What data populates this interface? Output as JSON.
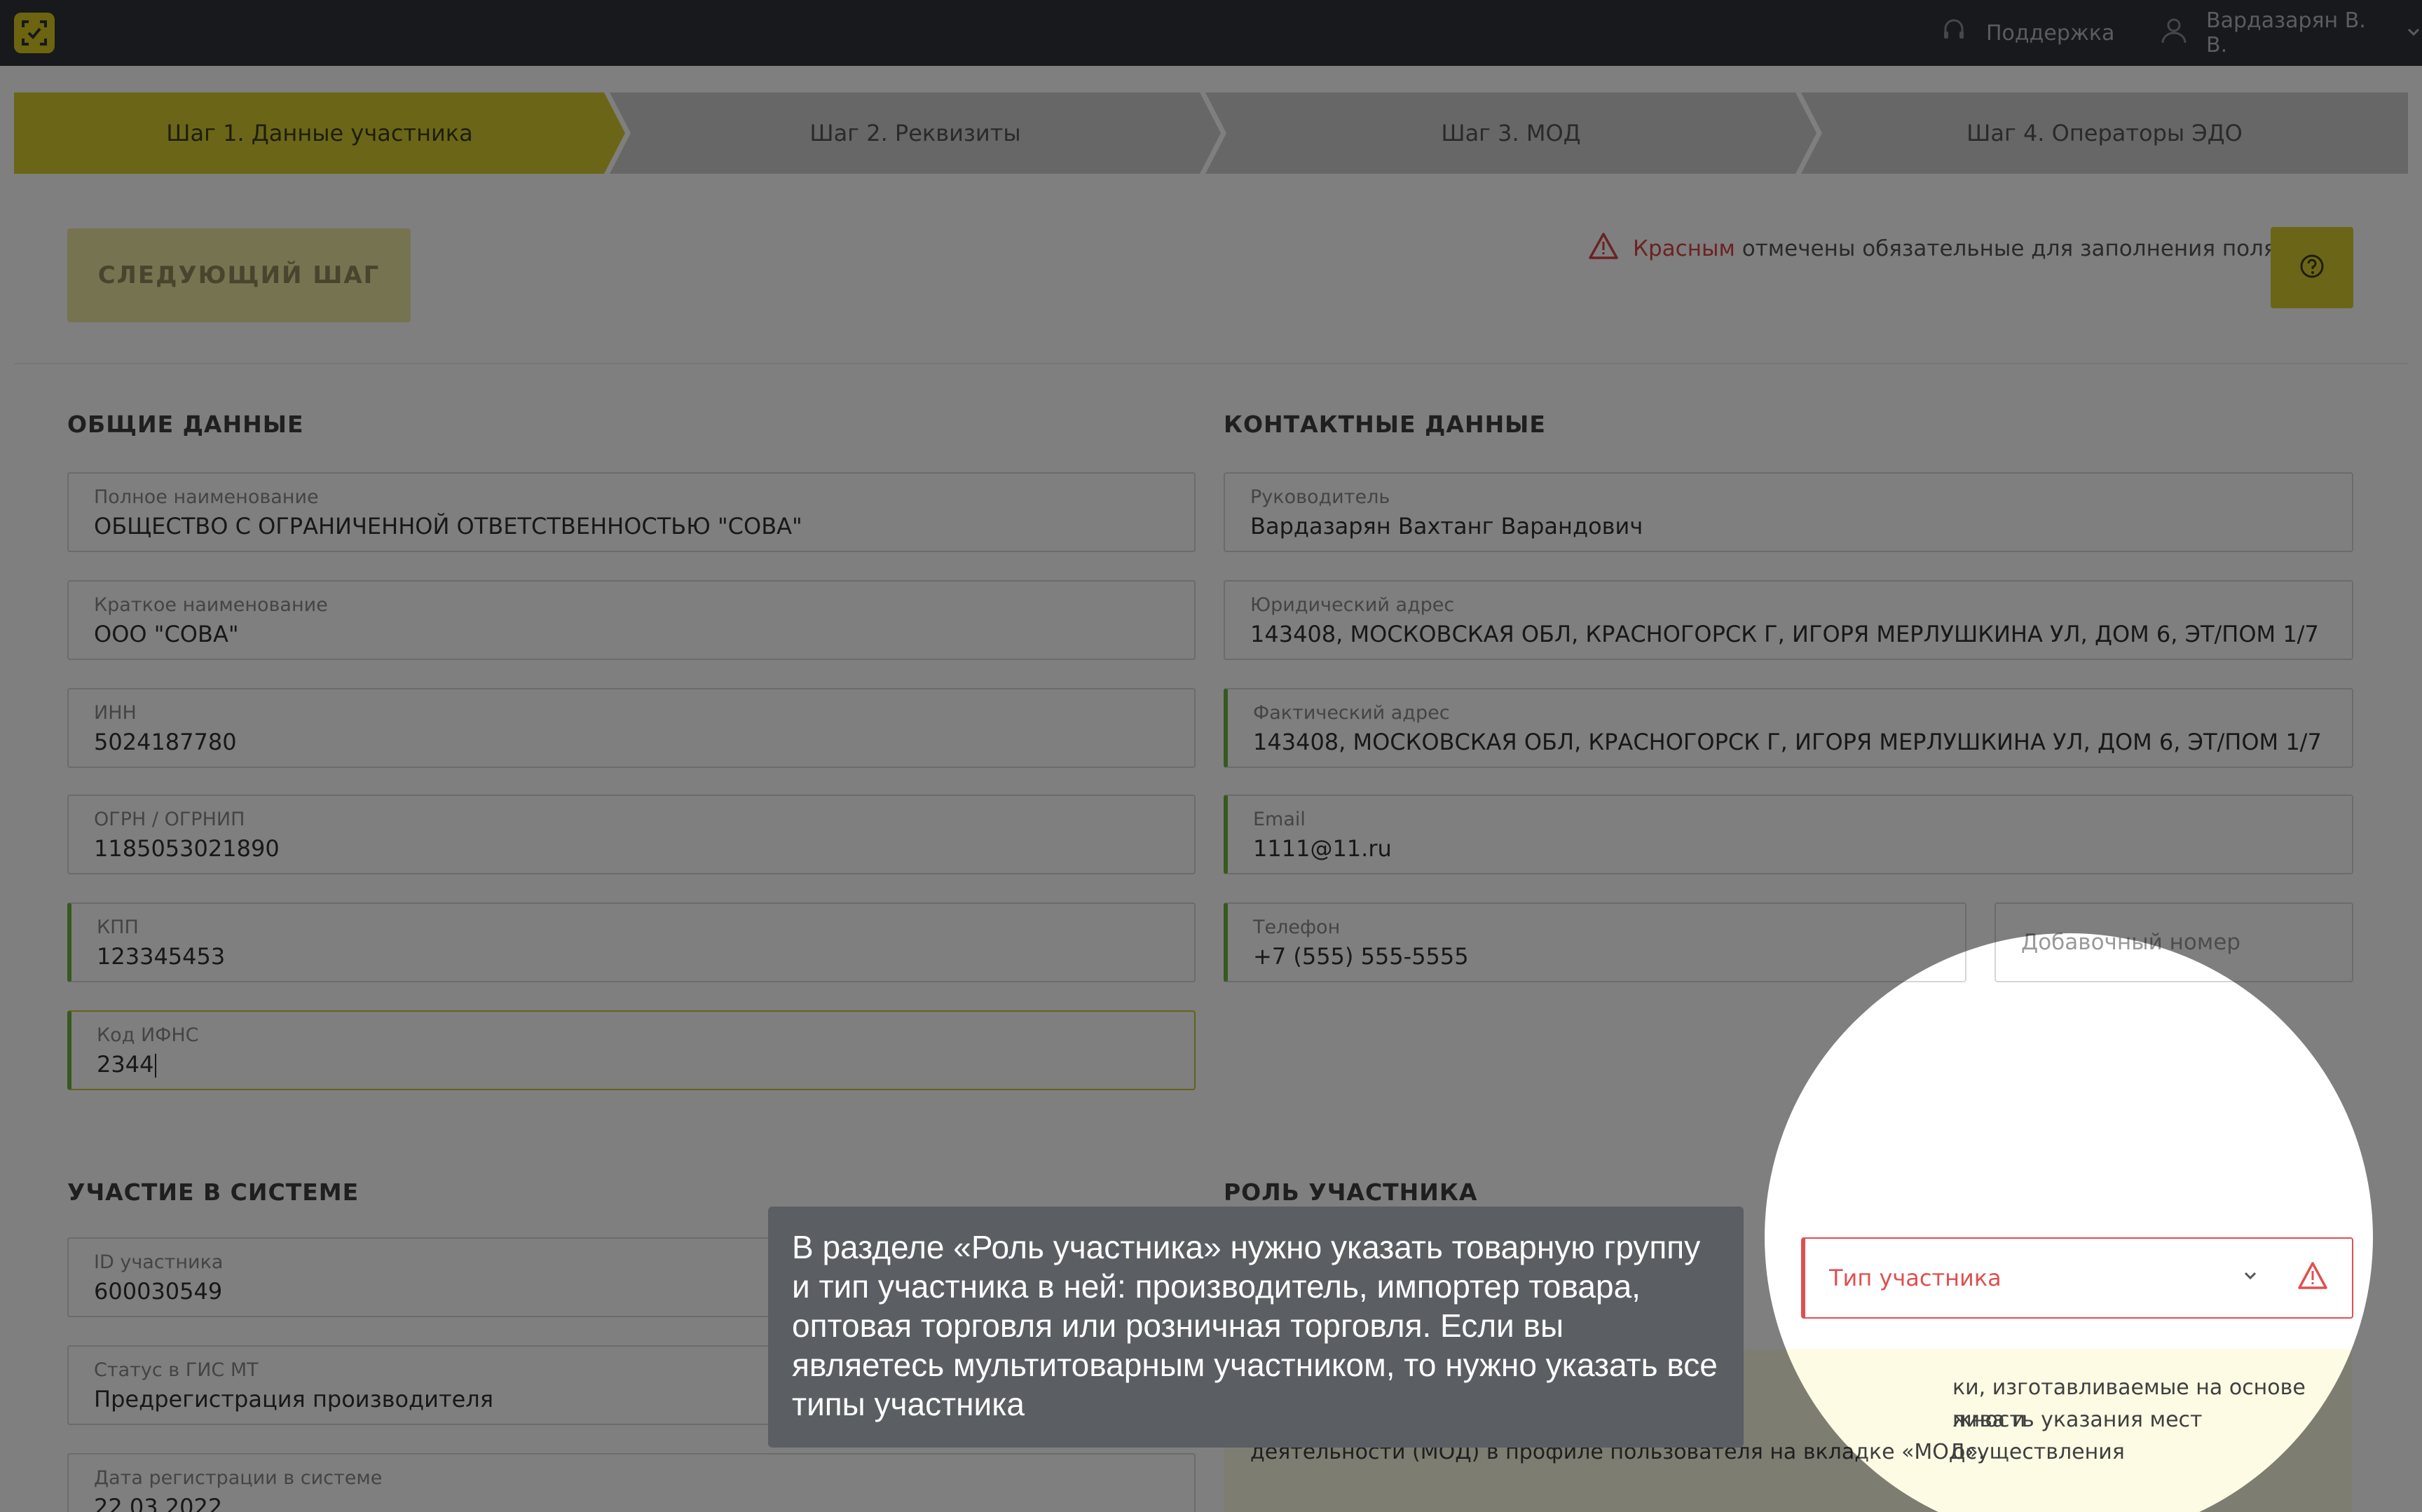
{
  "header": {
    "support_label": "Поддержка",
    "user_name": "Вардазарян В. В."
  },
  "steps": [
    {
      "label": "Шаг 1. Данные участника"
    },
    {
      "label": "Шаг 2. Реквизиты"
    },
    {
      "label": "Шаг 3. МОД"
    },
    {
      "label": "Шаг 4. Операторы ЭДО"
    }
  ],
  "toolbar": {
    "next_label": "СЛЕДУЮЩИЙ ШАГ",
    "required_red": "Красным",
    "required_rest": "отмечены обязательные для заполнения поля"
  },
  "general": {
    "title": "ОБЩИЕ ДАННЫЕ",
    "full_name": {
      "label": "Полное наименование",
      "value": "ОБЩЕСТВО С ОГРАНИЧЕННОЙ ОТВЕТСТВЕННОСТЬЮ \"СОВА\""
    },
    "short_name": {
      "label": "Краткое наименование",
      "value": "ООО \"СОВА\""
    },
    "inn": {
      "label": "ИНН",
      "value": "5024187780"
    },
    "ogrn": {
      "label": "ОГРН / ОГРНИП",
      "value": "1185053021890"
    },
    "kpp": {
      "label": "КПП",
      "value": "123345453"
    },
    "ifns": {
      "label": "Код ИФНС",
      "value": "2344"
    }
  },
  "contacts": {
    "title": "КОНТАКТНЫЕ ДАННЫЕ",
    "head": {
      "label": "Руководитель",
      "value": "Вардазарян Вахтанг Варандович"
    },
    "legal_address": {
      "label": "Юридический адрес",
      "value": "143408, МОСКОВСКАЯ ОБЛ, КРАСНОГОРСК Г, ИГОРЯ МЕРЛУШКИНА УЛ, ДОМ 6, ЭТ/ПОМ 1/7"
    },
    "actual_address": {
      "label": "Фактический адрес",
      "value": "143408, МОСКОВСКАЯ ОБЛ, КРАСНОГОРСК Г, ИГОРЯ МЕРЛУШКИНА УЛ, ДОМ 6, ЭТ/ПОМ 1/7"
    },
    "email": {
      "label": "Email",
      "value": "1111@11.ru"
    },
    "phone": {
      "label": "Телефон",
      "value": "+7 (555) 555-5555"
    },
    "extension_placeholder": "Добавочный номер"
  },
  "participation": {
    "title": "УЧАСТИЕ В СИСТЕМЕ",
    "participant_id": {
      "label": "ID участника",
      "value": "600030549"
    },
    "status": {
      "label": "Статус в ГИС МТ",
      "value": "Предрегистрация производителя"
    },
    "reg_date": {
      "label": "Дата регистрации в системе",
      "value": "22.03.2022"
    }
  },
  "role": {
    "title": "РОЛЬ УЧАСТНИКА",
    "type_placeholder": "Тип участника",
    "info_line1": "ки, изготавливаемые на основе пива и",
    "info_line2": "жность указания мест осуществления",
    "info_line3": "деятельности (МОД) в профиле пользователя на вкладке «МОД»."
  },
  "tooltip": {
    "text": "В разделе «Роль участника» нужно указать товарную группу и тип участника в ней: производитель, импортер товара, оптовая торговля или розничная торговля. Если вы являетесь мультитоварным участником, то нужно указать все типы участника"
  },
  "colors": {
    "accent": "#d7cd2f",
    "error": "#e05050",
    "valid": "#6fb23f",
    "topbar": "#2f3238"
  },
  "icons": [
    "logo-icon",
    "headset-icon",
    "user-icon",
    "chevron-down-icon",
    "warning-icon",
    "help-icon"
  ]
}
